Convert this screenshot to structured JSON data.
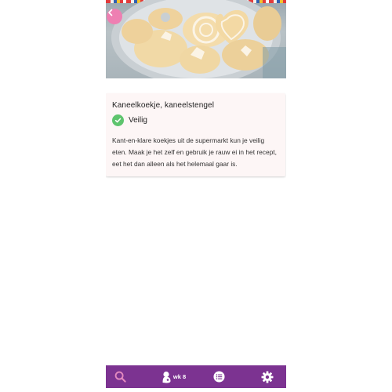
{
  "hero": {
    "image_name": "cinnamon-cookies-photo",
    "back_icon": "chevron-left-icon"
  },
  "card": {
    "title": "Kaneelkoekje, kaneelstengel",
    "status_icon": "check-circle-icon",
    "status_label": "Veilig",
    "status_color": "#5ec46e",
    "body": "Kant-en-klare koekjes uit de supermarkt kun je veilig eten. Maak je het zelf en gebruik je rauw ei in het recept, eet het dan alleen als het helemaal gaar is."
  },
  "nav": {
    "background": "#7c3391",
    "search_icon": "search-icon",
    "week_icon": "baby-icon",
    "week_label": "wk 8",
    "list_icon": "list-icon",
    "settings_icon": "gear-icon"
  },
  "colors": {
    "accent_pink": "#ee7fb2",
    "safe_green": "#5ec46e",
    "nav_purple": "#7c3391"
  }
}
